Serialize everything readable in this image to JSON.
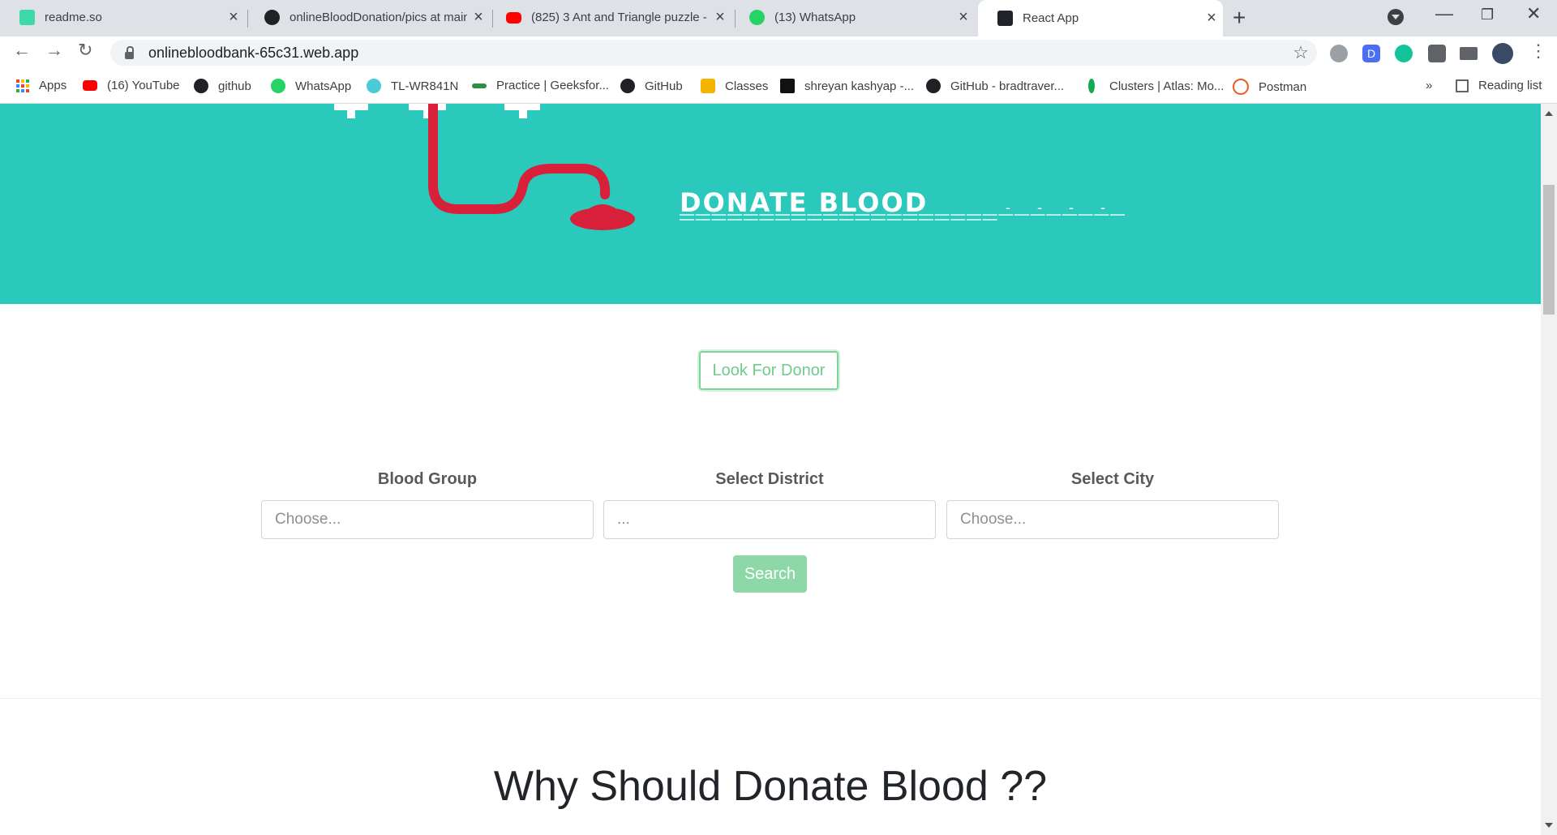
{
  "browser": {
    "tabs": [
      {
        "title": "readme.so",
        "icon": "readme-icon",
        "active": false
      },
      {
        "title": "onlineBloodDonation/pics at main",
        "icon": "github-icon",
        "active": false
      },
      {
        "title": "(825) 3 Ant and Triangle puzzle -",
        "icon": "youtube-icon",
        "active": false
      },
      {
        "title": "(13) WhatsApp",
        "icon": "whatsapp-icon",
        "active": false
      },
      {
        "title": "React App",
        "icon": "react-icon",
        "active": true
      }
    ],
    "url": "onlinebloodbank-65c31.web.app",
    "bookmarks": [
      {
        "label": "Apps"
      },
      {
        "label": "(16) YouTube"
      },
      {
        "label": "github"
      },
      {
        "label": "WhatsApp"
      },
      {
        "label": "TL-WR841N"
      },
      {
        "label": "Practice | Geeksfor..."
      },
      {
        "label": "GitHub"
      },
      {
        "label": "Classes"
      },
      {
        "label": "shreyan kashyap -..."
      },
      {
        "label": "GitHub - bradtraver..."
      },
      {
        "label": "Clusters | Atlas: Mo..."
      },
      {
        "label": "Postman"
      }
    ],
    "more_bookmarks": "»",
    "reading_list": "Reading list",
    "ext_badge": "D"
  },
  "hero": {
    "title": "DONATE BLOOD"
  },
  "page": {
    "look_for_donor": "Look For Donor",
    "filters": [
      {
        "label": "Blood Group",
        "placeholder": "Choose..."
      },
      {
        "label": "Select District",
        "placeholder": "..."
      },
      {
        "label": "Select City",
        "placeholder": "Choose..."
      }
    ],
    "search_label": "Search",
    "why_heading": "Why Should Donate Blood ??"
  },
  "colors": {
    "hero_bg": "#2bc9bb",
    "accent_green": "#7dd49a",
    "search_bg": "#8dd8a6",
    "blood_red": "#d8203a"
  }
}
